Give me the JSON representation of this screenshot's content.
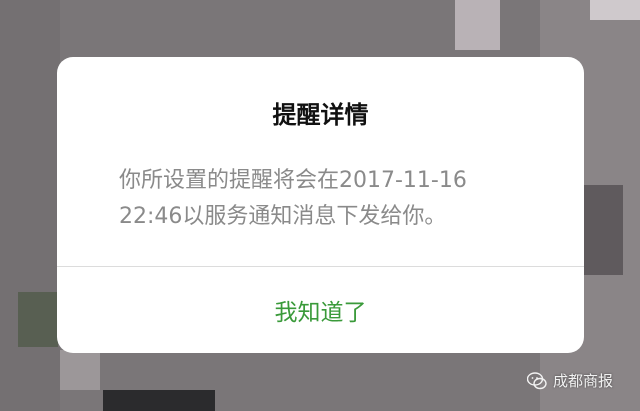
{
  "dialog": {
    "title": "提醒详情",
    "message": "你所设置的提醒将会在2017-11-16\n22:46以服务通知消息下发给你。",
    "button_label": "我知道了"
  },
  "watermark": {
    "icon": "wechat-icon",
    "text": "成都商报"
  },
  "colors": {
    "button_text": "#3a9a3a",
    "message_text": "#8a8a8a",
    "title_text": "#111111",
    "overlay_bg": "#7a7678"
  }
}
